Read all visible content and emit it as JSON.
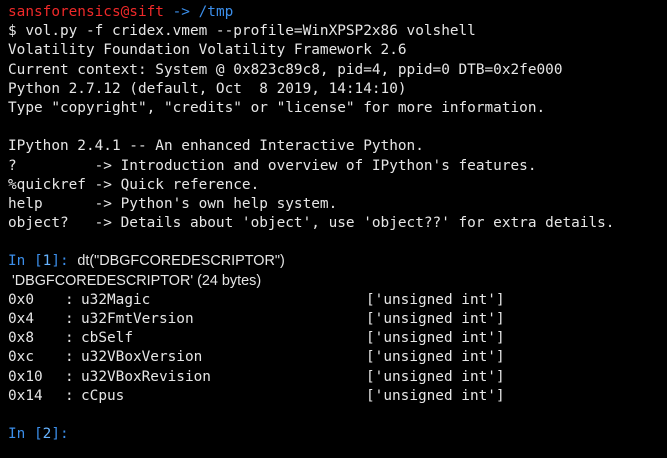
{
  "window": {
    "prompt_user_host": "sansforensics@sift",
    "prompt_arrow": "->",
    "prompt_path": "/tmp"
  },
  "terminal": {
    "lines": [
      "$ vol.py -f cridex.vmem --profile=WinXPSP2x86 volshell",
      "Volatility Foundation Volatility Framework 2.6",
      "Current context: System @ 0x823c89c8, pid=4, ppid=0 DTB=0x2fe000",
      "Python 2.7.12 (default, Oct  8 2019, 14:14:10)",
      "Type \"copyright\", \"credits\" or \"license\" for more information.",
      "",
      "IPython 2.4.1 -- An enhanced Interactive Python.",
      "?         -> Introduction and overview of IPython's features.",
      "%quickref -> Quick reference.",
      "help      -> Python's own help system.",
      "object?   -> Details about 'object', use 'object??' for extra details.",
      ""
    ],
    "in1": {
      "label": "In [",
      "num": "1",
      "close": "]: ",
      "command": "dt(\"DBGFCOREDESCRIPTOR\")"
    },
    "struct_header": " 'DBGFCOREDESCRIPTOR' (24 bytes)",
    "fields": [
      {
        "offset": "0x0",
        "colon": ":",
        "name": "u32Magic",
        "type": "['unsigned int']"
      },
      {
        "offset": "0x4",
        "colon": ":",
        "name": "u32FmtVersion",
        "type": "['unsigned int']"
      },
      {
        "offset": "0x8",
        "colon": ":",
        "name": "cbSelf",
        "type": "['unsigned int']"
      },
      {
        "offset": "0xc",
        "colon": ":",
        "name": "u32VBoxVersion",
        "type": "['unsigned int']"
      },
      {
        "offset": "0x10",
        "colon": ":",
        "name": "u32VBoxRevision",
        "type": "['unsigned int']"
      },
      {
        "offset": "0x14",
        "colon": ":",
        "name": "cCpus",
        "type": "['unsigned int']"
      }
    ],
    "in2": {
      "label": "In [",
      "num": "2",
      "close": "]:"
    }
  }
}
